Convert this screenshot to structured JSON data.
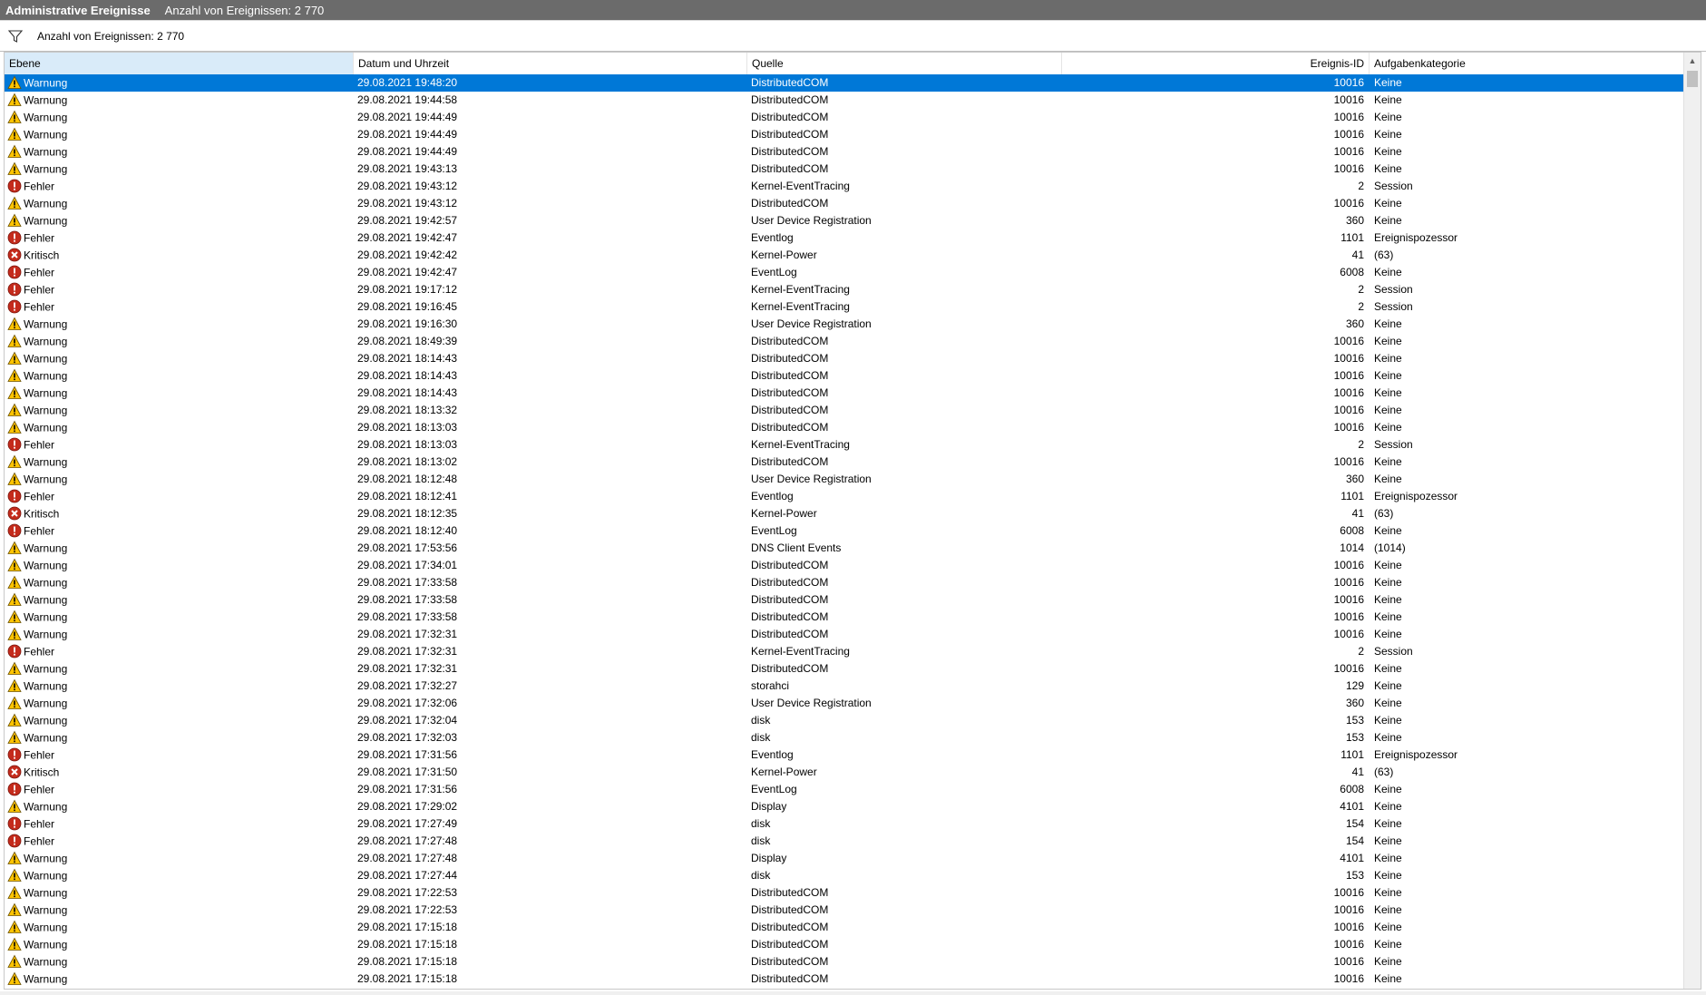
{
  "window": {
    "title": "Administrative Ereignisse",
    "subtitle": "Anzahl von Ereignissen: 2 770"
  },
  "filter": {
    "icon": "filter-icon",
    "text": "Anzahl von Ereignissen: 2 770"
  },
  "columns": {
    "level": "Ebene",
    "date": "Datum und Uhrzeit",
    "source": "Quelle",
    "id": "Ereignis-ID",
    "category": "Aufgabenkategorie"
  },
  "colors": {
    "selection": "#0078d7",
    "sorted_header": "#d9ebf9",
    "warning": "#ffc300",
    "error": "#c42b1c",
    "critical": "#c42b1c"
  },
  "rows": [
    {
      "level": "Warnung",
      "type": "warning",
      "date": "29.08.2021 19:48:20",
      "source": "DistributedCOM",
      "id": "10016",
      "category": "Keine",
      "selected": true
    },
    {
      "level": "Warnung",
      "type": "warning",
      "date": "29.08.2021 19:44:58",
      "source": "DistributedCOM",
      "id": "10016",
      "category": "Keine"
    },
    {
      "level": "Warnung",
      "type": "warning",
      "date": "29.08.2021 19:44:49",
      "source": "DistributedCOM",
      "id": "10016",
      "category": "Keine"
    },
    {
      "level": "Warnung",
      "type": "warning",
      "date": "29.08.2021 19:44:49",
      "source": "DistributedCOM",
      "id": "10016",
      "category": "Keine"
    },
    {
      "level": "Warnung",
      "type": "warning",
      "date": "29.08.2021 19:44:49",
      "source": "DistributedCOM",
      "id": "10016",
      "category": "Keine"
    },
    {
      "level": "Warnung",
      "type": "warning",
      "date": "29.08.2021 19:43:13",
      "source": "DistributedCOM",
      "id": "10016",
      "category": "Keine"
    },
    {
      "level": "Fehler",
      "type": "error",
      "date": "29.08.2021 19:43:12",
      "source": "Kernel-EventTracing",
      "id": "2",
      "category": "Session"
    },
    {
      "level": "Warnung",
      "type": "warning",
      "date": "29.08.2021 19:43:12",
      "source": "DistributedCOM",
      "id": "10016",
      "category": "Keine"
    },
    {
      "level": "Warnung",
      "type": "warning",
      "date": "29.08.2021 19:42:57",
      "source": "User Device Registration",
      "id": "360",
      "category": "Keine"
    },
    {
      "level": "Fehler",
      "type": "error",
      "date": "29.08.2021 19:42:47",
      "source": "Eventlog",
      "id": "1101",
      "category": "Ereignispozessor"
    },
    {
      "level": "Kritisch",
      "type": "critical",
      "date": "29.08.2021 19:42:42",
      "source": "Kernel-Power",
      "id": "41",
      "category": "(63)"
    },
    {
      "level": "Fehler",
      "type": "error",
      "date": "29.08.2021 19:42:47",
      "source": "EventLog",
      "id": "6008",
      "category": "Keine"
    },
    {
      "level": "Fehler",
      "type": "error",
      "date": "29.08.2021 19:17:12",
      "source": "Kernel-EventTracing",
      "id": "2",
      "category": "Session"
    },
    {
      "level": "Fehler",
      "type": "error",
      "date": "29.08.2021 19:16:45",
      "source": "Kernel-EventTracing",
      "id": "2",
      "category": "Session"
    },
    {
      "level": "Warnung",
      "type": "warning",
      "date": "29.08.2021 19:16:30",
      "source": "User Device Registration",
      "id": "360",
      "category": "Keine"
    },
    {
      "level": "Warnung",
      "type": "warning",
      "date": "29.08.2021 18:49:39",
      "source": "DistributedCOM",
      "id": "10016",
      "category": "Keine"
    },
    {
      "level": "Warnung",
      "type": "warning",
      "date": "29.08.2021 18:14:43",
      "source": "DistributedCOM",
      "id": "10016",
      "category": "Keine"
    },
    {
      "level": "Warnung",
      "type": "warning",
      "date": "29.08.2021 18:14:43",
      "source": "DistributedCOM",
      "id": "10016",
      "category": "Keine"
    },
    {
      "level": "Warnung",
      "type": "warning",
      "date": "29.08.2021 18:14:43",
      "source": "DistributedCOM",
      "id": "10016",
      "category": "Keine"
    },
    {
      "level": "Warnung",
      "type": "warning",
      "date": "29.08.2021 18:13:32",
      "source": "DistributedCOM",
      "id": "10016",
      "category": "Keine"
    },
    {
      "level": "Warnung",
      "type": "warning",
      "date": "29.08.2021 18:13:03",
      "source": "DistributedCOM",
      "id": "10016",
      "category": "Keine"
    },
    {
      "level": "Fehler",
      "type": "error",
      "date": "29.08.2021 18:13:03",
      "source": "Kernel-EventTracing",
      "id": "2",
      "category": "Session"
    },
    {
      "level": "Warnung",
      "type": "warning",
      "date": "29.08.2021 18:13:02",
      "source": "DistributedCOM",
      "id": "10016",
      "category": "Keine"
    },
    {
      "level": "Warnung",
      "type": "warning",
      "date": "29.08.2021 18:12:48",
      "source": "User Device Registration",
      "id": "360",
      "category": "Keine"
    },
    {
      "level": "Fehler",
      "type": "error",
      "date": "29.08.2021 18:12:41",
      "source": "Eventlog",
      "id": "1101",
      "category": "Ereignispozessor"
    },
    {
      "level": "Kritisch",
      "type": "critical",
      "date": "29.08.2021 18:12:35",
      "source": "Kernel-Power",
      "id": "41",
      "category": "(63)"
    },
    {
      "level": "Fehler",
      "type": "error",
      "date": "29.08.2021 18:12:40",
      "source": "EventLog",
      "id": "6008",
      "category": "Keine"
    },
    {
      "level": "Warnung",
      "type": "warning",
      "date": "29.08.2021 17:53:56",
      "source": "DNS Client Events",
      "id": "1014",
      "category": "(1014)"
    },
    {
      "level": "Warnung",
      "type": "warning",
      "date": "29.08.2021 17:34:01",
      "source": "DistributedCOM",
      "id": "10016",
      "category": "Keine"
    },
    {
      "level": "Warnung",
      "type": "warning",
      "date": "29.08.2021 17:33:58",
      "source": "DistributedCOM",
      "id": "10016",
      "category": "Keine"
    },
    {
      "level": "Warnung",
      "type": "warning",
      "date": "29.08.2021 17:33:58",
      "source": "DistributedCOM",
      "id": "10016",
      "category": "Keine"
    },
    {
      "level": "Warnung",
      "type": "warning",
      "date": "29.08.2021 17:33:58",
      "source": "DistributedCOM",
      "id": "10016",
      "category": "Keine"
    },
    {
      "level": "Warnung",
      "type": "warning",
      "date": "29.08.2021 17:32:31",
      "source": "DistributedCOM",
      "id": "10016",
      "category": "Keine"
    },
    {
      "level": "Fehler",
      "type": "error",
      "date": "29.08.2021 17:32:31",
      "source": "Kernel-EventTracing",
      "id": "2",
      "category": "Session"
    },
    {
      "level": "Warnung",
      "type": "warning",
      "date": "29.08.2021 17:32:31",
      "source": "DistributedCOM",
      "id": "10016",
      "category": "Keine"
    },
    {
      "level": "Warnung",
      "type": "warning",
      "date": "29.08.2021 17:32:27",
      "source": "storahci",
      "id": "129",
      "category": "Keine"
    },
    {
      "level": "Warnung",
      "type": "warning",
      "date": "29.08.2021 17:32:06",
      "source": "User Device Registration",
      "id": "360",
      "category": "Keine"
    },
    {
      "level": "Warnung",
      "type": "warning",
      "date": "29.08.2021 17:32:04",
      "source": "disk",
      "id": "153",
      "category": "Keine"
    },
    {
      "level": "Warnung",
      "type": "warning",
      "date": "29.08.2021 17:32:03",
      "source": "disk",
      "id": "153",
      "category": "Keine"
    },
    {
      "level": "Fehler",
      "type": "error",
      "date": "29.08.2021 17:31:56",
      "source": "Eventlog",
      "id": "1101",
      "category": "Ereignispozessor"
    },
    {
      "level": "Kritisch",
      "type": "critical",
      "date": "29.08.2021 17:31:50",
      "source": "Kernel-Power",
      "id": "41",
      "category": "(63)"
    },
    {
      "level": "Fehler",
      "type": "error",
      "date": "29.08.2021 17:31:56",
      "source": "EventLog",
      "id": "6008",
      "category": "Keine"
    },
    {
      "level": "Warnung",
      "type": "warning",
      "date": "29.08.2021 17:29:02",
      "source": "Display",
      "id": "4101",
      "category": "Keine"
    },
    {
      "level": "Fehler",
      "type": "error",
      "date": "29.08.2021 17:27:49",
      "source": "disk",
      "id": "154",
      "category": "Keine"
    },
    {
      "level": "Fehler",
      "type": "error",
      "date": "29.08.2021 17:27:48",
      "source": "disk",
      "id": "154",
      "category": "Keine"
    },
    {
      "level": "Warnung",
      "type": "warning",
      "date": "29.08.2021 17:27:48",
      "source": "Display",
      "id": "4101",
      "category": "Keine"
    },
    {
      "level": "Warnung",
      "type": "warning",
      "date": "29.08.2021 17:27:44",
      "source": "disk",
      "id": "153",
      "category": "Keine"
    },
    {
      "level": "Warnung",
      "type": "warning",
      "date": "29.08.2021 17:22:53",
      "source": "DistributedCOM",
      "id": "10016",
      "category": "Keine"
    },
    {
      "level": "Warnung",
      "type": "warning",
      "date": "29.08.2021 17:22:53",
      "source": "DistributedCOM",
      "id": "10016",
      "category": "Keine"
    },
    {
      "level": "Warnung",
      "type": "warning",
      "date": "29.08.2021 17:15:18",
      "source": "DistributedCOM",
      "id": "10016",
      "category": "Keine"
    },
    {
      "level": "Warnung",
      "type": "warning",
      "date": "29.08.2021 17:15:18",
      "source": "DistributedCOM",
      "id": "10016",
      "category": "Keine"
    },
    {
      "level": "Warnung",
      "type": "warning",
      "date": "29.08.2021 17:15:18",
      "source": "DistributedCOM",
      "id": "10016",
      "category": "Keine"
    },
    {
      "level": "Warnung",
      "type": "warning",
      "date": "29.08.2021 17:15:18",
      "source": "DistributedCOM",
      "id": "10016",
      "category": "Keine"
    }
  ]
}
